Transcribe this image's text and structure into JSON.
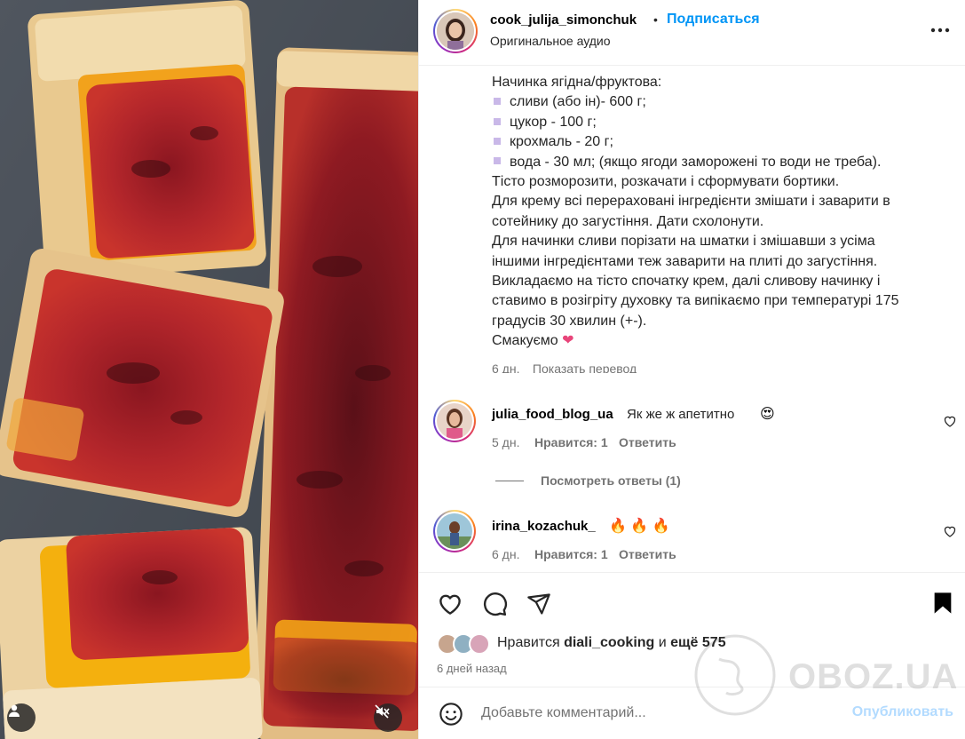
{
  "header": {
    "username": "cook_julija_simonchuk",
    "separator": "•",
    "follow_label": "Подписаться",
    "audio_label": "Оригинальное аудио",
    "more_icon": "more-horizontal-icon"
  },
  "caption": {
    "lines": [
      "Начинка ягідна/фруктова:",
      "сливи (або ін)- 600 г;",
      "цукор - 100 г;",
      "крохмаль - 20 г;",
      "вода - 30 мл; (якщо ягоди заморожені то води не треба).",
      "Тісто розморозити, розкачати і сформувати бортики.",
      "Для крему всі перераховані інгредієнти змішати і заварити в",
      "сотейнику до загустіння. Дати схолонути.",
      "Для начинки сливи порізати на шматки і змішавши з усіма",
      "іншими інгредієнтами теж заварити на плиті до загустіння.",
      "Викладаємо на тісто спочатку крем, далі сливову начинку і",
      "ставимо в розігріту духовку та випікаємо при температурі 175",
      "градусів 30 хвилин (+-).",
      "Смакуємо"
    ],
    "emoji_end": "❤",
    "time": "6 дн.",
    "translate_label": "Показать перевод"
  },
  "comments": [
    {
      "username": "julia_food_blog_ua",
      "text": "Як же ж апетитно",
      "emoji": "😍",
      "time": "5 дн.",
      "likes": "Нравится: 1",
      "reply": "Ответить"
    },
    {
      "username": "irina_kozachuk_",
      "text": "",
      "emoji": "🔥 🔥 🔥",
      "time": "6 дн.",
      "likes": "Нравится: 1",
      "reply": "Ответить"
    }
  ],
  "view_replies_label": "Посмотреть ответы (1)",
  "actions": {
    "like_icon": "heart-icon",
    "comment_icon": "comment-icon",
    "share_icon": "share-icon",
    "save_icon": "bookmark-icon"
  },
  "likes": {
    "prefix": "Нравится",
    "user": "diali_cooking",
    "and": "и",
    "rest": "ещё 575"
  },
  "time_ago": "6 дней назад",
  "comment_box": {
    "placeholder": "Добавьте комментарий...",
    "publish_label": "Опубликовать",
    "emoji_icon": "smiley-icon"
  },
  "watermark": "OBOZ.UA",
  "colors": {
    "accent": "#0095f6",
    "publish_disabled": "#b3dbff",
    "muted_text": "#737373"
  }
}
